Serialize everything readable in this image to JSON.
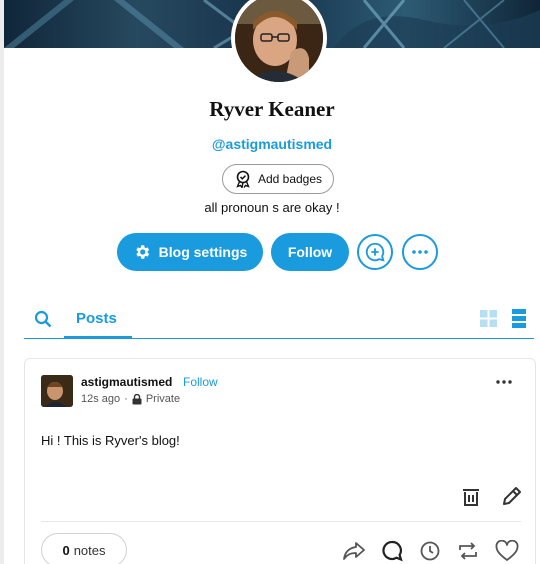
{
  "profile": {
    "name": "Ryver Keaner",
    "handle": "@astigmautismed",
    "badges_label": "Add badges",
    "bio": "all pronoun s are okay !"
  },
  "actions": {
    "blog_settings_label": "Blog settings",
    "follow_label": "Follow"
  },
  "tabs": {
    "posts_label": "Posts"
  },
  "post": {
    "author": "astigmautismed",
    "follow_label": "Follow",
    "time": "12s ago",
    "separator": "·",
    "visibility": "Private",
    "body": "Hi ! This is Ryver's blog!",
    "notes_count": "0",
    "notes_label": "notes"
  },
  "colors": {
    "accent": "#1a9bde",
    "text": "#111111",
    "border": "#e6e6e6"
  },
  "icons": [
    "add-badge-icon",
    "gear-icon",
    "add-post-icon",
    "more-icon",
    "search-icon",
    "grid-view-icon",
    "list-view-icon",
    "lock-icon",
    "trash-icon",
    "edit-icon",
    "share-icon",
    "reply-icon",
    "queue-icon",
    "reblog-icon",
    "heart-icon"
  ]
}
